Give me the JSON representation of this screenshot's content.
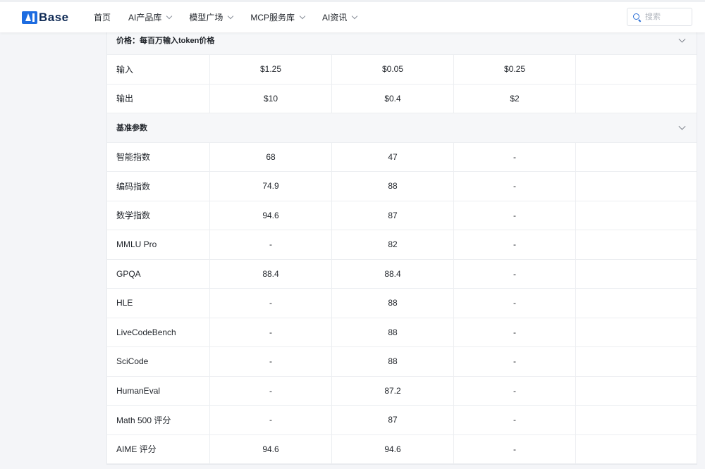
{
  "brand": {
    "logo_text": "Base"
  },
  "nav": {
    "items": [
      {
        "label": "首页",
        "has_dropdown": false
      },
      {
        "label": "AI产品库",
        "has_dropdown": true
      },
      {
        "label": "模型广场",
        "has_dropdown": true
      },
      {
        "label": "MCP服务库",
        "has_dropdown": true
      },
      {
        "label": "AI资讯",
        "has_dropdown": true
      }
    ]
  },
  "search": {
    "placeholder": "搜索",
    "value": ""
  },
  "pricing": {
    "title": "价格：每百万输入token价格",
    "rows": [
      {
        "label": "输入",
        "values": [
          "$1.25",
          "$0.05",
          "$0.25"
        ]
      },
      {
        "label": "输出",
        "values": [
          "$10",
          "$0.4",
          "$2"
        ]
      }
    ]
  },
  "benchmarks": {
    "title": "基准参数",
    "rows": [
      {
        "label": "智能指数",
        "values": [
          "68",
          "47",
          "-"
        ]
      },
      {
        "label": "编码指数",
        "values": [
          "74.9",
          "88",
          "-"
        ]
      },
      {
        "label": "数学指数",
        "values": [
          "94.6",
          "87",
          "-"
        ]
      },
      {
        "label": "MMLU Pro",
        "values": [
          "-",
          "82",
          "-"
        ]
      },
      {
        "label": "GPQA",
        "values": [
          "88.4",
          "88.4",
          "-"
        ]
      },
      {
        "label": "HLE",
        "values": [
          "-",
          "88",
          "-"
        ]
      },
      {
        "label": "LiveCodeBench",
        "values": [
          "-",
          "88",
          "-"
        ]
      },
      {
        "label": "SciCode",
        "values": [
          "-",
          "88",
          "-"
        ]
      },
      {
        "label": "HumanEval",
        "values": [
          "-",
          "87.2",
          "-"
        ]
      },
      {
        "label": "Math 500 评分",
        "values": [
          "-",
          "87",
          "-"
        ]
      },
      {
        "label": "AIME 评分",
        "values": [
          "94.6",
          "94.6",
          "-"
        ]
      }
    ]
  },
  "colors": {
    "brand_blue": "#1d6ce0",
    "header_bg": "#f6f7f9",
    "border": "#eceef1"
  }
}
